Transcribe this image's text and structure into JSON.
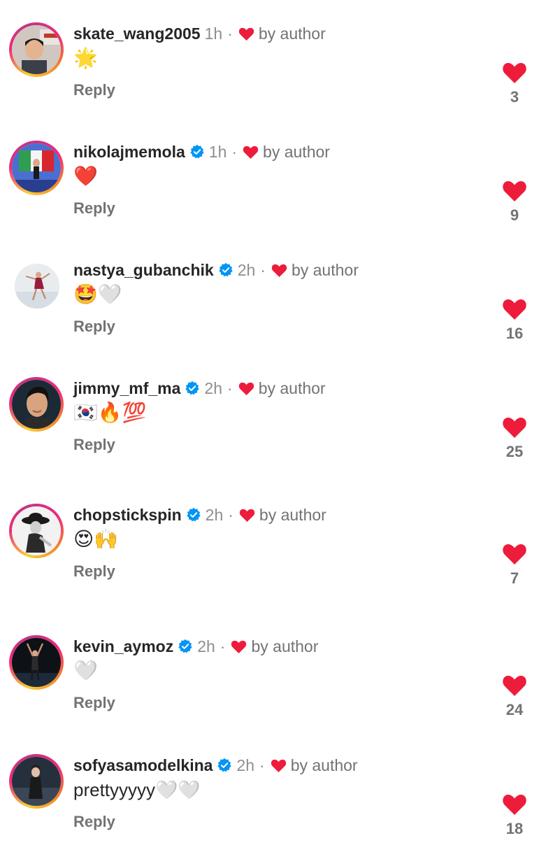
{
  "colors": {
    "like_red": "#ed1c3b",
    "verified_blue": "#0095f6",
    "muted_text": "#737373",
    "primary_text": "#262626"
  },
  "comments": [
    {
      "username": "skate_wang2005",
      "verified": false,
      "time": "1h",
      "separator": "·",
      "by_author": "by author",
      "body": "🌟",
      "reply_label": "Reply",
      "likes": "3",
      "avatar_icon": "avatar-photo-child"
    },
    {
      "username": "nikolajmemola",
      "verified": true,
      "time": "1h",
      "separator": "·",
      "by_author": "by author",
      "body": "❤️",
      "reply_label": "Reply",
      "likes": "9",
      "avatar_icon": "avatar-photo-skater-flag"
    },
    {
      "username": "nastya_gubanchik",
      "verified": true,
      "time": "2h",
      "separator": "·",
      "by_author": "by author",
      "body": "🤩🤍",
      "reply_label": "Reply",
      "likes": "16",
      "avatar_icon": "avatar-photo-skater-ice"
    },
    {
      "username": "jimmy_mf_ma",
      "verified": true,
      "time": "2h",
      "separator": "·",
      "by_author": "by author",
      "body": "🇰🇷🔥💯",
      "reply_label": "Reply",
      "likes": "25",
      "avatar_icon": "avatar-photo-portrait"
    },
    {
      "username": "chopstickspin",
      "verified": true,
      "time": "2h",
      "separator": "·",
      "by_author": "by author",
      "body": "😍🙌",
      "reply_label": "Reply",
      "likes": "7",
      "avatar_icon": "avatar-photo-bw-hat"
    },
    {
      "username": "kevin_aymoz",
      "verified": true,
      "time": "2h",
      "separator": "·",
      "by_author": "by author",
      "body": "🤍",
      "reply_label": "Reply",
      "likes": "24",
      "avatar_icon": "avatar-photo-dark-skater"
    },
    {
      "username": "sofyasamodelkina",
      "verified": true,
      "time": "2h",
      "separator": "·",
      "by_author": "by author",
      "body": "prettyyyyy🤍🤍",
      "reply_label": "Reply",
      "likes": "18",
      "avatar_icon": "avatar-photo-skater-dark"
    }
  ]
}
